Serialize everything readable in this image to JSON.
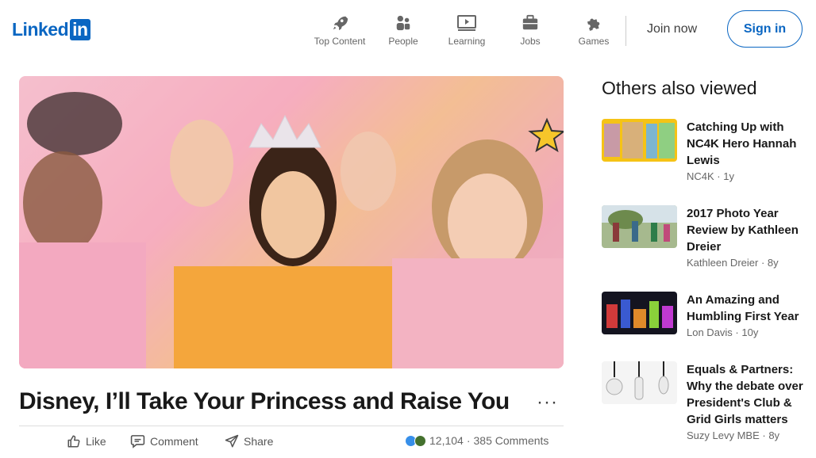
{
  "brand": {
    "logo_text": "Linked",
    "logo_badge": "in"
  },
  "nav": [
    {
      "label": "Top Content",
      "icon": "rocket-icon"
    },
    {
      "label": "People",
      "icon": "people-icon"
    },
    {
      "label": "Learning",
      "icon": "learning-icon"
    },
    {
      "label": "Jobs",
      "icon": "briefcase-icon"
    },
    {
      "label": "Games",
      "icon": "puzzle-icon"
    }
  ],
  "auth": {
    "join": "Join now",
    "signin": "Sign in"
  },
  "article": {
    "title": "Disney, I’ll Take Your Princess and Raise You",
    "more": "···",
    "actions": {
      "like": "Like",
      "comment": "Comment",
      "share": "Share"
    },
    "reactions_count": "12,104",
    "comments": "385 Comments"
  },
  "sidebar": {
    "title": "Others also viewed",
    "items": [
      {
        "title": "Catching Up with NC4K Hero Hannah Lewis",
        "author": "NC4K",
        "age": "1y"
      },
      {
        "title": "2017 Photo Year Review by Kathleen Dreier",
        "author": "Kathleen Dreier",
        "age": "8y"
      },
      {
        "title": "An Amazing and Humbling First Year",
        "author": "Lon Davis",
        "age": "10y"
      },
      {
        "title": "Equals & Partners: Why the debate over President's Club & Grid Girls matters",
        "author": "Suzy Levy MBE",
        "age": "8y"
      }
    ]
  },
  "colors": {
    "brand": "#0a66c2",
    "text": "#191919",
    "muted": "#666666"
  }
}
